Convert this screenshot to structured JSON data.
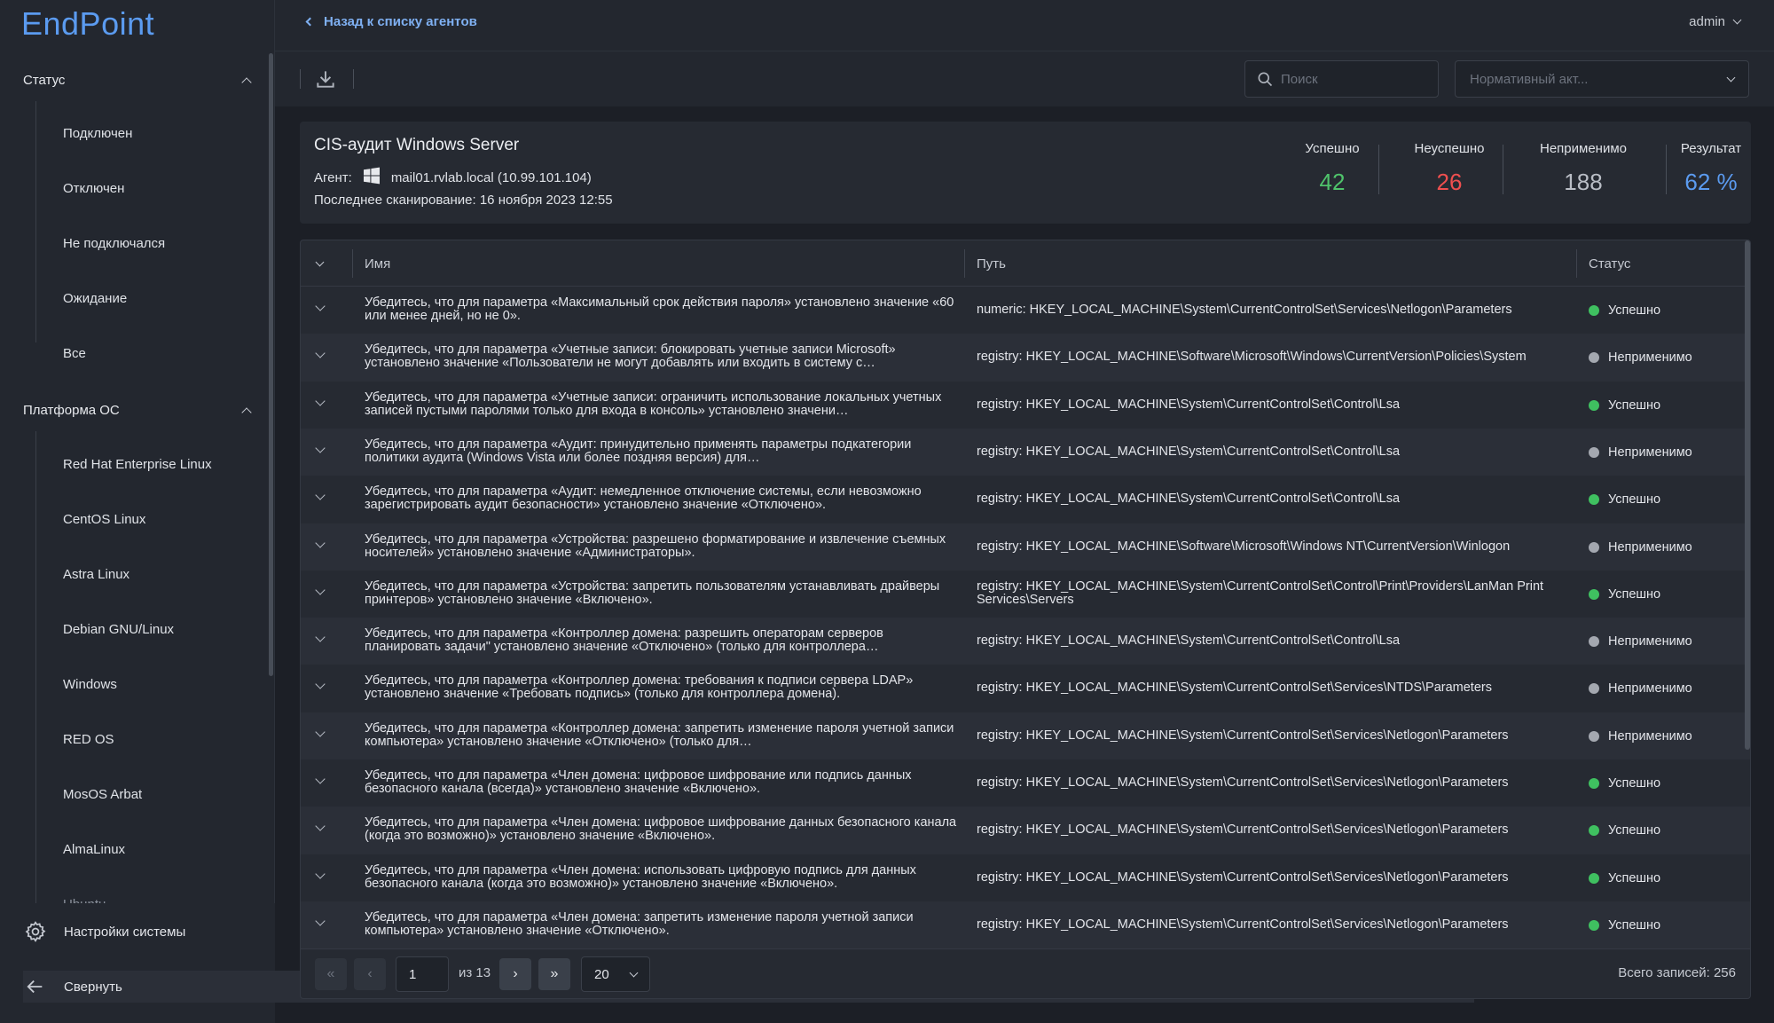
{
  "app": {
    "logo": "EndPoint"
  },
  "sidebar": {
    "status_group": {
      "title": "Статус",
      "items": [
        "Подключен",
        "Отключен",
        "Не подключался",
        "Ожидание",
        "Все"
      ]
    },
    "platform_group": {
      "title": "Платформа ОС",
      "items": [
        "Red Hat Enterprise Linux",
        "CentOS Linux",
        "Astra Linux",
        "Debian GNU/Linux",
        "Windows",
        "RED OS",
        "MosOS Arbat",
        "AlmaLinux",
        "Ubuntu"
      ]
    },
    "settings_label": "Настройки системы",
    "collapse_label": "Свернуть"
  },
  "header": {
    "back_label": "Назад к списку агентов",
    "user": "admin"
  },
  "toolbar": {
    "search_placeholder": "Поиск",
    "standard_placeholder": "Нормативный акт..."
  },
  "summary": {
    "title": "CIS-аудит Windows Server",
    "agent_label": "Агент:",
    "agent_value": "mail01.rvlab.local (10.99.101.104)",
    "scan_label": "Последнее сканирование: 16 ноября 2023 12:55",
    "stats": {
      "success_label": "Успешно",
      "success_value": "42",
      "fail_label": "Неуспешно",
      "fail_value": "26",
      "na_label": "Неприменимо",
      "na_value": "188",
      "result_label": "Результат",
      "result_value": "62 %"
    },
    "colors": {
      "success": "#4fc36b",
      "fail": "#ee4f4f",
      "na": "#b9bdc5",
      "result": "#5b9bf0"
    }
  },
  "table": {
    "columns": {
      "name": "Имя",
      "path": "Путь",
      "status": "Статус"
    },
    "rows": [
      {
        "name": "Убедитесь, что для параметра «Максимальный срок действия пароля» установлено значение «60 или менее дней, но не 0».",
        "path": "numeric: HKEY_LOCAL_MACHINE\\System\\CurrentControlSet\\Services\\Netlogon\\Parameters",
        "status": "Успешно",
        "kind": "ok"
      },
      {
        "name": "Убедитесь, что для параметра «Учетные записи: блокировать учетные записи Microsoft» установлено значение «Пользователи не могут добавлять или входить в систему с…",
        "path": "registry: HKEY_LOCAL_MACHINE\\Software\\Microsoft\\Windows\\CurrentVersion\\Policies\\System",
        "status": "Неприменимо",
        "kind": "na"
      },
      {
        "name": "Убедитесь, что для параметра «Учетные записи: ограничить использование локальных учетных записей пустыми паролями только для входа в консоль» установлено значени…",
        "path": "registry: HKEY_LOCAL_MACHINE\\System\\CurrentControlSet\\Control\\Lsa",
        "status": "Успешно",
        "kind": "ok"
      },
      {
        "name": "Убедитесь, что для параметра «Аудит: принудительно применять параметры подкатегории политики аудита (Windows Vista или более поздняя версия) для…",
        "path": "registry: HKEY_LOCAL_MACHINE\\System\\CurrentControlSet\\Control\\Lsa",
        "status": "Неприменимо",
        "kind": "na"
      },
      {
        "name": "Убедитесь, что для параметра «Аудит: немедленное отключение системы, если невозможно зарегистрировать аудит безопасности» установлено значение «Отключено».",
        "path": "registry: HKEY_LOCAL_MACHINE\\System\\CurrentControlSet\\Control\\Lsa",
        "status": "Успешно",
        "kind": "ok"
      },
      {
        "name": "Убедитесь, что для параметра «Устройства: разрешено форматирование и извлечение съемных носителей» установлено значение «Администраторы».",
        "path": "registry: HKEY_LOCAL_MACHINE\\Software\\Microsoft\\Windows NT\\CurrentVersion\\Winlogon",
        "status": "Неприменимо",
        "kind": "na"
      },
      {
        "name": "Убедитесь, что для параметра «Устройства: запретить пользователям устанавливать драйверы принтеров» установлено значение «Включено».",
        "path": "registry: HKEY_LOCAL_MACHINE\\System\\CurrentControlSet\\Control\\Print\\Providers\\LanMan Print Services\\Servers",
        "status": "Успешно",
        "kind": "ok"
      },
      {
        "name": "Убедитесь, что для параметра «Контроллер домена: разрешить операторам серверов планировать задачи\" установлено значение «Отключено» (только для контроллера…",
        "path": "registry: HKEY_LOCAL_MACHINE\\System\\CurrentControlSet\\Control\\Lsa",
        "status": "Неприменимо",
        "kind": "na"
      },
      {
        "name": "Убедитесь, что для параметра «Контроллер домена: требования к подписи сервера LDAP» установлено значение «Требовать подпись» (только для контроллера домена).",
        "path": "registry: HKEY_LOCAL_MACHINE\\System\\CurrentControlSet\\Services\\NTDS\\Parameters",
        "status": "Неприменимо",
        "kind": "na"
      },
      {
        "name": "Убедитесь, что для параметра «Контроллер домена: запретить изменение пароля учетной записи компьютера» установлено значение «Отключено» (только для…",
        "path": "registry: HKEY_LOCAL_MACHINE\\System\\CurrentControlSet\\Services\\Netlogon\\Parameters",
        "status": "Неприменимо",
        "kind": "na"
      },
      {
        "name": "Убедитесь, что для параметра «Член домена: цифровое шифрование или подпись данных безопасного канала (всегда)» установлено значение «Включено».",
        "path": "registry: HKEY_LOCAL_MACHINE\\System\\CurrentControlSet\\Services\\Netlogon\\Parameters",
        "status": "Успешно",
        "kind": "ok"
      },
      {
        "name": "Убедитесь, что для параметра «Член домена: цифровое шифрование данных безопасного канала (когда это возможно)» установлено значение «Включено».",
        "path": "registry: HKEY_LOCAL_MACHINE\\System\\CurrentControlSet\\Services\\Netlogon\\Parameters",
        "status": "Успешно",
        "kind": "ok"
      },
      {
        "name": "Убедитесь, что для параметра «Член домена: использовать цифровую подпись для данных безопасного канала (когда это возможно)» установлено значение «Включено».",
        "path": "registry: HKEY_LOCAL_MACHINE\\System\\CurrentControlSet\\Services\\Netlogon\\Parameters",
        "status": "Успешно",
        "kind": "ok"
      },
      {
        "name": "Убедитесь, что для параметра «Член домена: запретить изменение пароля учетной записи компьютера» установлено значение «Отключено».",
        "path": "registry: HKEY_LOCAL_MACHINE\\System\\CurrentControlSet\\Services\\Netlogon\\Parameters",
        "status": "Успешно",
        "kind": "ok"
      }
    ],
    "status_colors": {
      "ok": "#3fc060",
      "na": "#a4a8b0"
    }
  },
  "pager": {
    "page": "1",
    "of_label": "из 13",
    "page_size": "20",
    "total_label": "Всего записей: 256"
  }
}
